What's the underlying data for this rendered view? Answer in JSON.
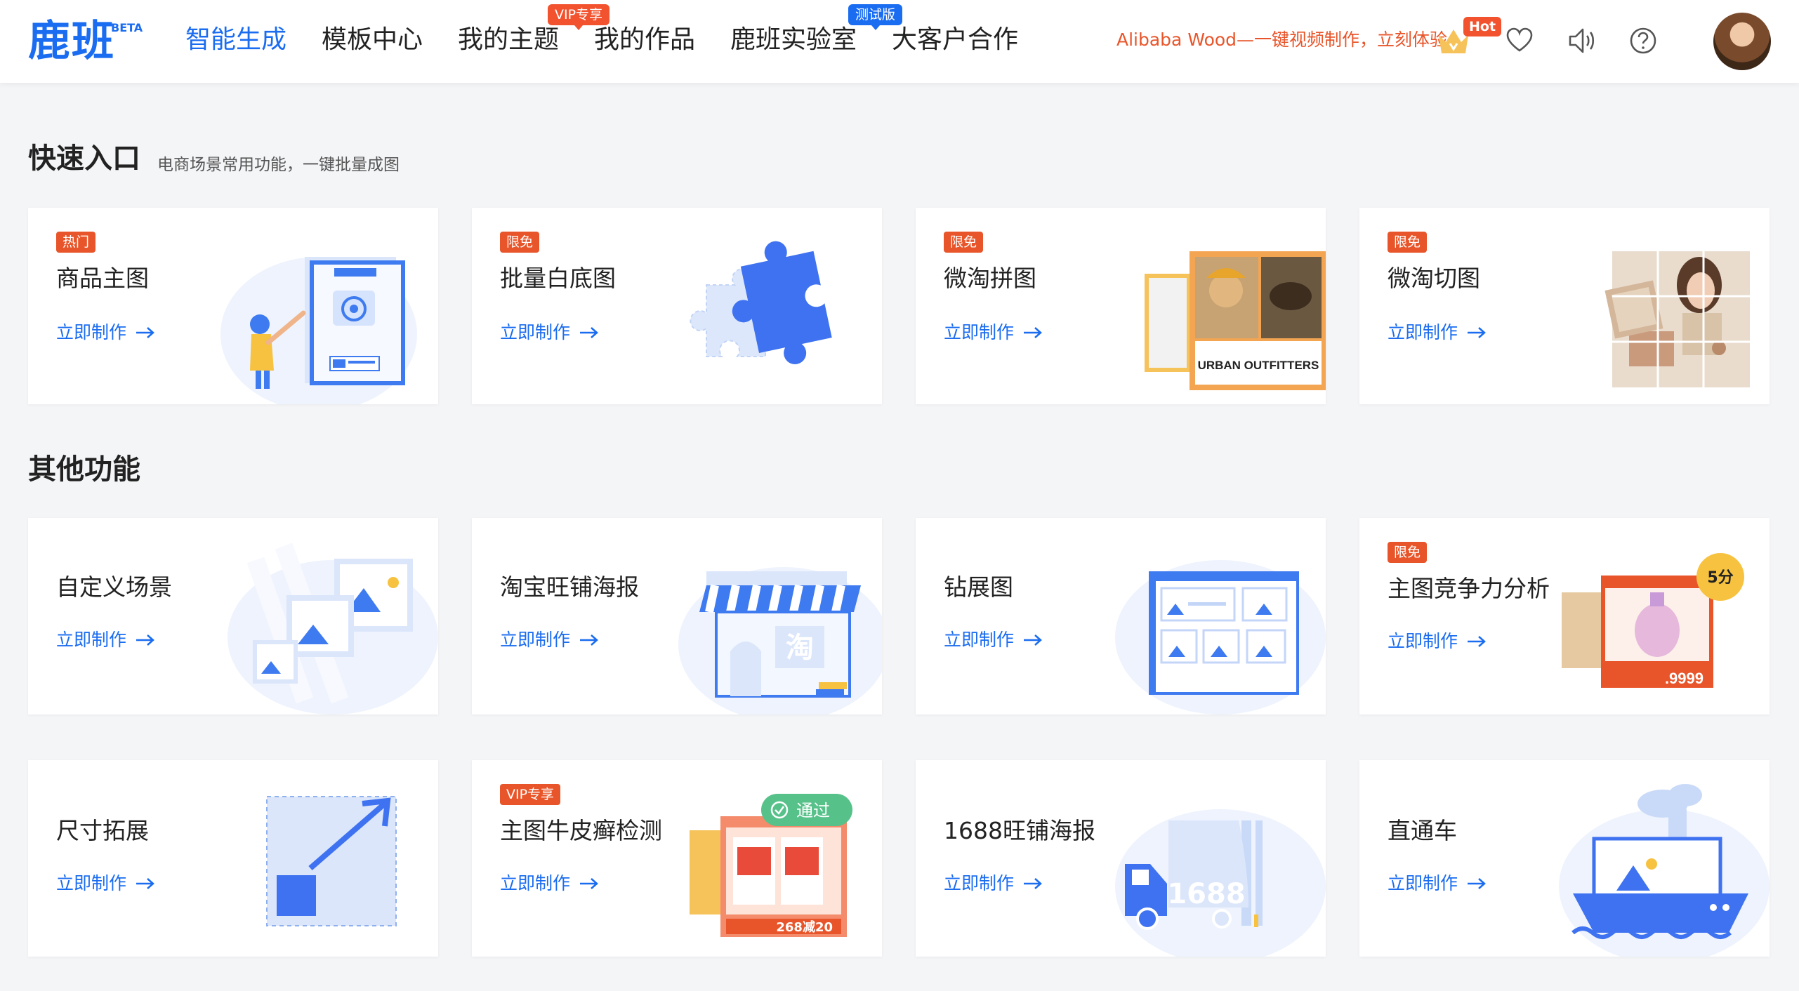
{
  "header": {
    "logo": "鹿班",
    "logo_badge": "BETA",
    "nav": [
      {
        "label": "智能生成",
        "active": true
      },
      {
        "label": "模板中心"
      },
      {
        "label": "我的主题",
        "badge": "VIP专享"
      },
      {
        "label": "我的作品"
      },
      {
        "label": "鹿班实验室"
      },
      {
        "label": "大客户合作",
        "badge": "测试版"
      }
    ],
    "promo": "Alibaba Wood—一键视频制作，立刻体验",
    "hot_badge": "Hot",
    "icons": [
      "crown-icon",
      "heart-icon",
      "speaker-icon",
      "help-icon",
      "avatar"
    ]
  },
  "quick": {
    "title": "快速入口",
    "subtitle": "电商场景常用功能，一键批量成图",
    "cards": [
      {
        "tag": "热门",
        "title": "商品主图",
        "link": "立即制作"
      },
      {
        "tag": "限免",
        "title": "批量白底图",
        "link": "立即制作"
      },
      {
        "tag": "限免",
        "title": "微淘拼图",
        "link": "立即制作",
        "art_text": "URBAN OUTFITTERS"
      },
      {
        "tag": "限免",
        "title": "微淘切图",
        "link": "立即制作"
      }
    ]
  },
  "other": {
    "title": "其他功能",
    "cards": [
      {
        "title": "自定义场景",
        "link": "立即制作"
      },
      {
        "title": "淘宝旺铺海报",
        "link": "立即制作",
        "art_text": "淘"
      },
      {
        "title": "钻展图",
        "link": "立即制作"
      },
      {
        "tag": "限免",
        "title": "主图竞争力分析",
        "link": "立即制作",
        "art_text": "5分",
        "art_price": ".9999"
      },
      {
        "title": "尺寸拓展",
        "link": "立即制作"
      },
      {
        "tag": "VIP专享",
        "title": "主图牛皮癣检测",
        "link": "立即制作",
        "art_text": "通过",
        "art_price": "268减20"
      },
      {
        "title": "1688旺铺海报",
        "link": "立即制作",
        "art_text": "1688"
      },
      {
        "title": "直通车",
        "link": "立即制作"
      }
    ]
  },
  "colors": {
    "accent": "#1a6cf0",
    "tag": "#e8552a",
    "background": "#f4f5f7"
  }
}
